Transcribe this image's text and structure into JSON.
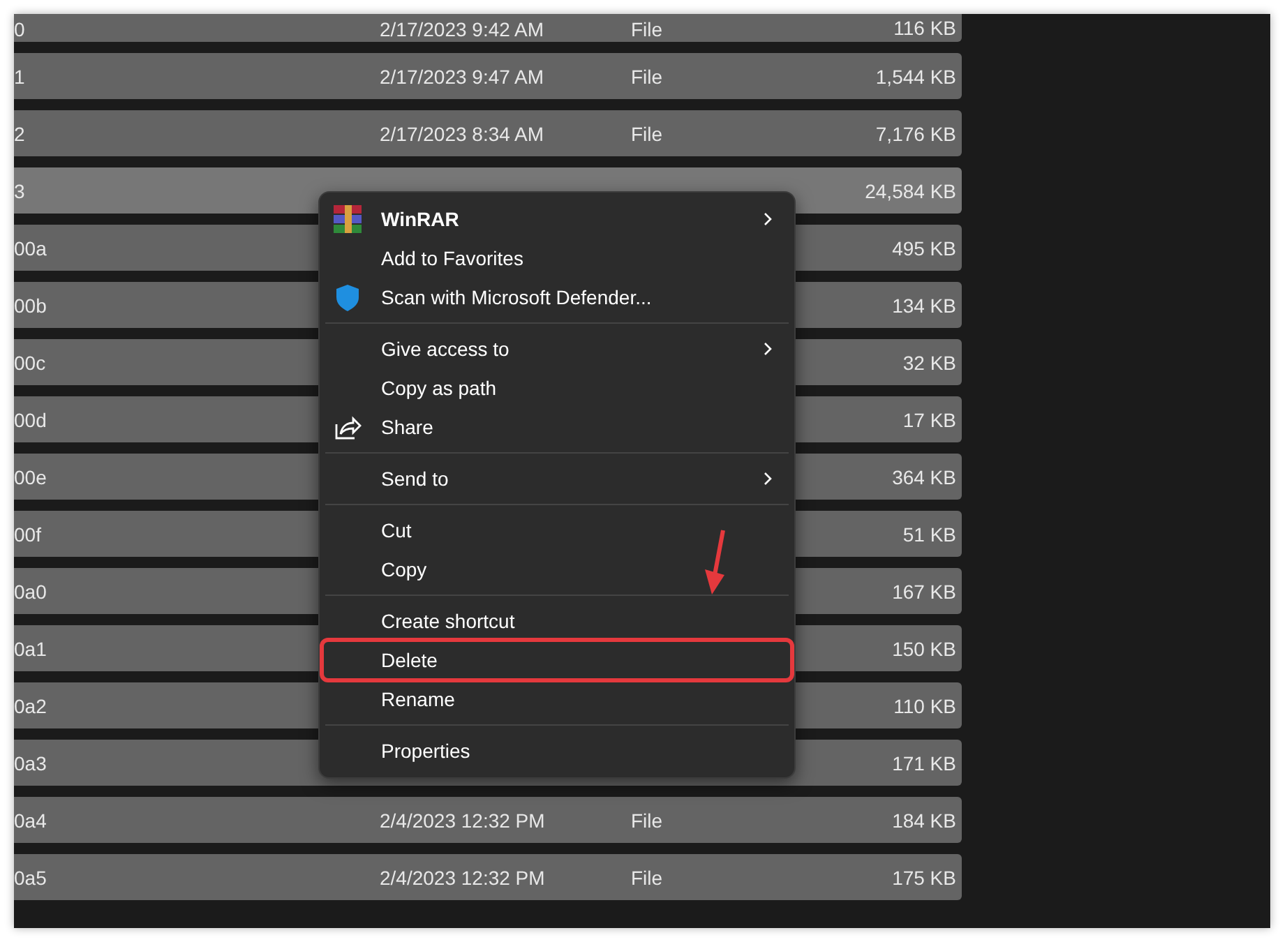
{
  "files": [
    {
      "name": "0",
      "date": "2/17/2023 9:42 AM",
      "type": "File",
      "size": "116 KB",
      "selected": false
    },
    {
      "name": "1",
      "date": "2/17/2023 9:47 AM",
      "type": "File",
      "size": "1,544 KB",
      "selected": false
    },
    {
      "name": "2",
      "date": "2/17/2023 8:34 AM",
      "type": "File",
      "size": "7,176 KB",
      "selected": false
    },
    {
      "name": "3",
      "size": "24,584 KB",
      "selected": true
    },
    {
      "name": "00a",
      "size": "495 KB",
      "selected": false
    },
    {
      "name": "00b",
      "size": "134 KB",
      "selected": false
    },
    {
      "name": "00c",
      "size": "32 KB",
      "selected": false
    },
    {
      "name": "00d",
      "size": "17 KB",
      "selected": false
    },
    {
      "name": "00e",
      "size": "364 KB",
      "selected": false
    },
    {
      "name": "00f",
      "size": "51 KB",
      "selected": false
    },
    {
      "name": "0a0",
      "size": "167 KB",
      "selected": false
    },
    {
      "name": "0a1",
      "size": "150 KB",
      "selected": false
    },
    {
      "name": "0a2",
      "size": "110 KB",
      "selected": false
    },
    {
      "name": "0a3",
      "size": "171 KB",
      "selected": false
    },
    {
      "name": "0a4",
      "date": "2/4/2023 12:32 PM",
      "type": "File",
      "size": "184 KB",
      "selected": false
    },
    {
      "name": "0a5",
      "date": "2/4/2023 12:32 PM",
      "type": "File",
      "size": "175 KB",
      "selected": false
    }
  ],
  "context_menu": {
    "groups": [
      [
        {
          "label": "WinRAR",
          "kind": "archive",
          "bold": true,
          "submenu": true,
          "highlighted": false
        },
        {
          "label": "Add to Favorites",
          "kind": "text",
          "bold": false,
          "submenu": false,
          "highlighted": false
        },
        {
          "label": "Scan with Microsoft Defender...",
          "kind": "antivirus",
          "bold": false,
          "submenu": false,
          "highlighted": false
        }
      ],
      [
        {
          "label": "Give access to",
          "kind": "text",
          "bold": false,
          "submenu": true,
          "highlighted": false
        },
        {
          "label": "Copy as path",
          "kind": "text",
          "bold": false,
          "submenu": false,
          "highlighted": false
        },
        {
          "label": "Share",
          "kind": "share",
          "bold": false,
          "submenu": false,
          "highlighted": false
        }
      ],
      [
        {
          "label": "Send to",
          "kind": "text",
          "bold": false,
          "submenu": true,
          "highlighted": false
        }
      ],
      [
        {
          "label": "Cut",
          "kind": "text",
          "bold": false,
          "submenu": false,
          "highlighted": false
        },
        {
          "label": "Copy",
          "kind": "text",
          "bold": false,
          "submenu": false,
          "highlighted": false
        }
      ],
      [
        {
          "label": "Create shortcut",
          "kind": "text",
          "bold": false,
          "submenu": false,
          "highlighted": false
        },
        {
          "label": "Delete",
          "kind": "text",
          "bold": false,
          "submenu": false,
          "highlighted": true
        },
        {
          "label": "Rename",
          "kind": "text",
          "bold": false,
          "submenu": false,
          "highlighted": false
        }
      ],
      [
        {
          "label": "Properties",
          "kind": "text",
          "bold": false,
          "submenu": false,
          "highlighted": false
        }
      ]
    ]
  },
  "annotations": [
    {
      "kind": "arrow"
    }
  ]
}
